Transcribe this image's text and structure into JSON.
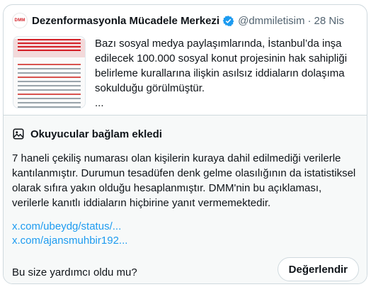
{
  "quoted_post": {
    "logo_text": "DMM",
    "author_name": "Dezenformasyonla Mücadele Merkezi",
    "handle": "@dmmiletisim",
    "separator": "·",
    "date": "28 Nis",
    "text": "Bazı sosyal medya paylaşımlarında, İstanbul’da inşa edilecek 100.000 sosyal konut projesinin hak sahipliği belirleme kurallarına ilişkin asılsız iddiaların dolaşıma sokulduğu görülmüştür.",
    "more": "...",
    "colors": {
      "brand": "#d32027",
      "verified": "#1d9bf0"
    }
  },
  "community_note": {
    "title": "Okuyucular bağlam ekledi",
    "body": "7 haneli çekiliş numarası olan kişilerin kuraya dahil edilmediği verilerle kantılanmıştır. Durumun tesadüfen denk gelme olasılığının da istatistiksel olarak sıfıra yakın olduğu hesaplanmıştır. DMM'nin bu açıklaması, verilerle kanıtlı iddiaların hiçbirine yanıt vermemektedir.",
    "links": [
      "x.com/ubeydg/status/...",
      "x.com/ajansmuhbir192..."
    ],
    "helpful_question": "Bu size yardımcı oldu mu?",
    "rate_button": "Değerlendir",
    "colors": {
      "link": "#1d9bf0",
      "background": "#f7f9f9"
    }
  }
}
